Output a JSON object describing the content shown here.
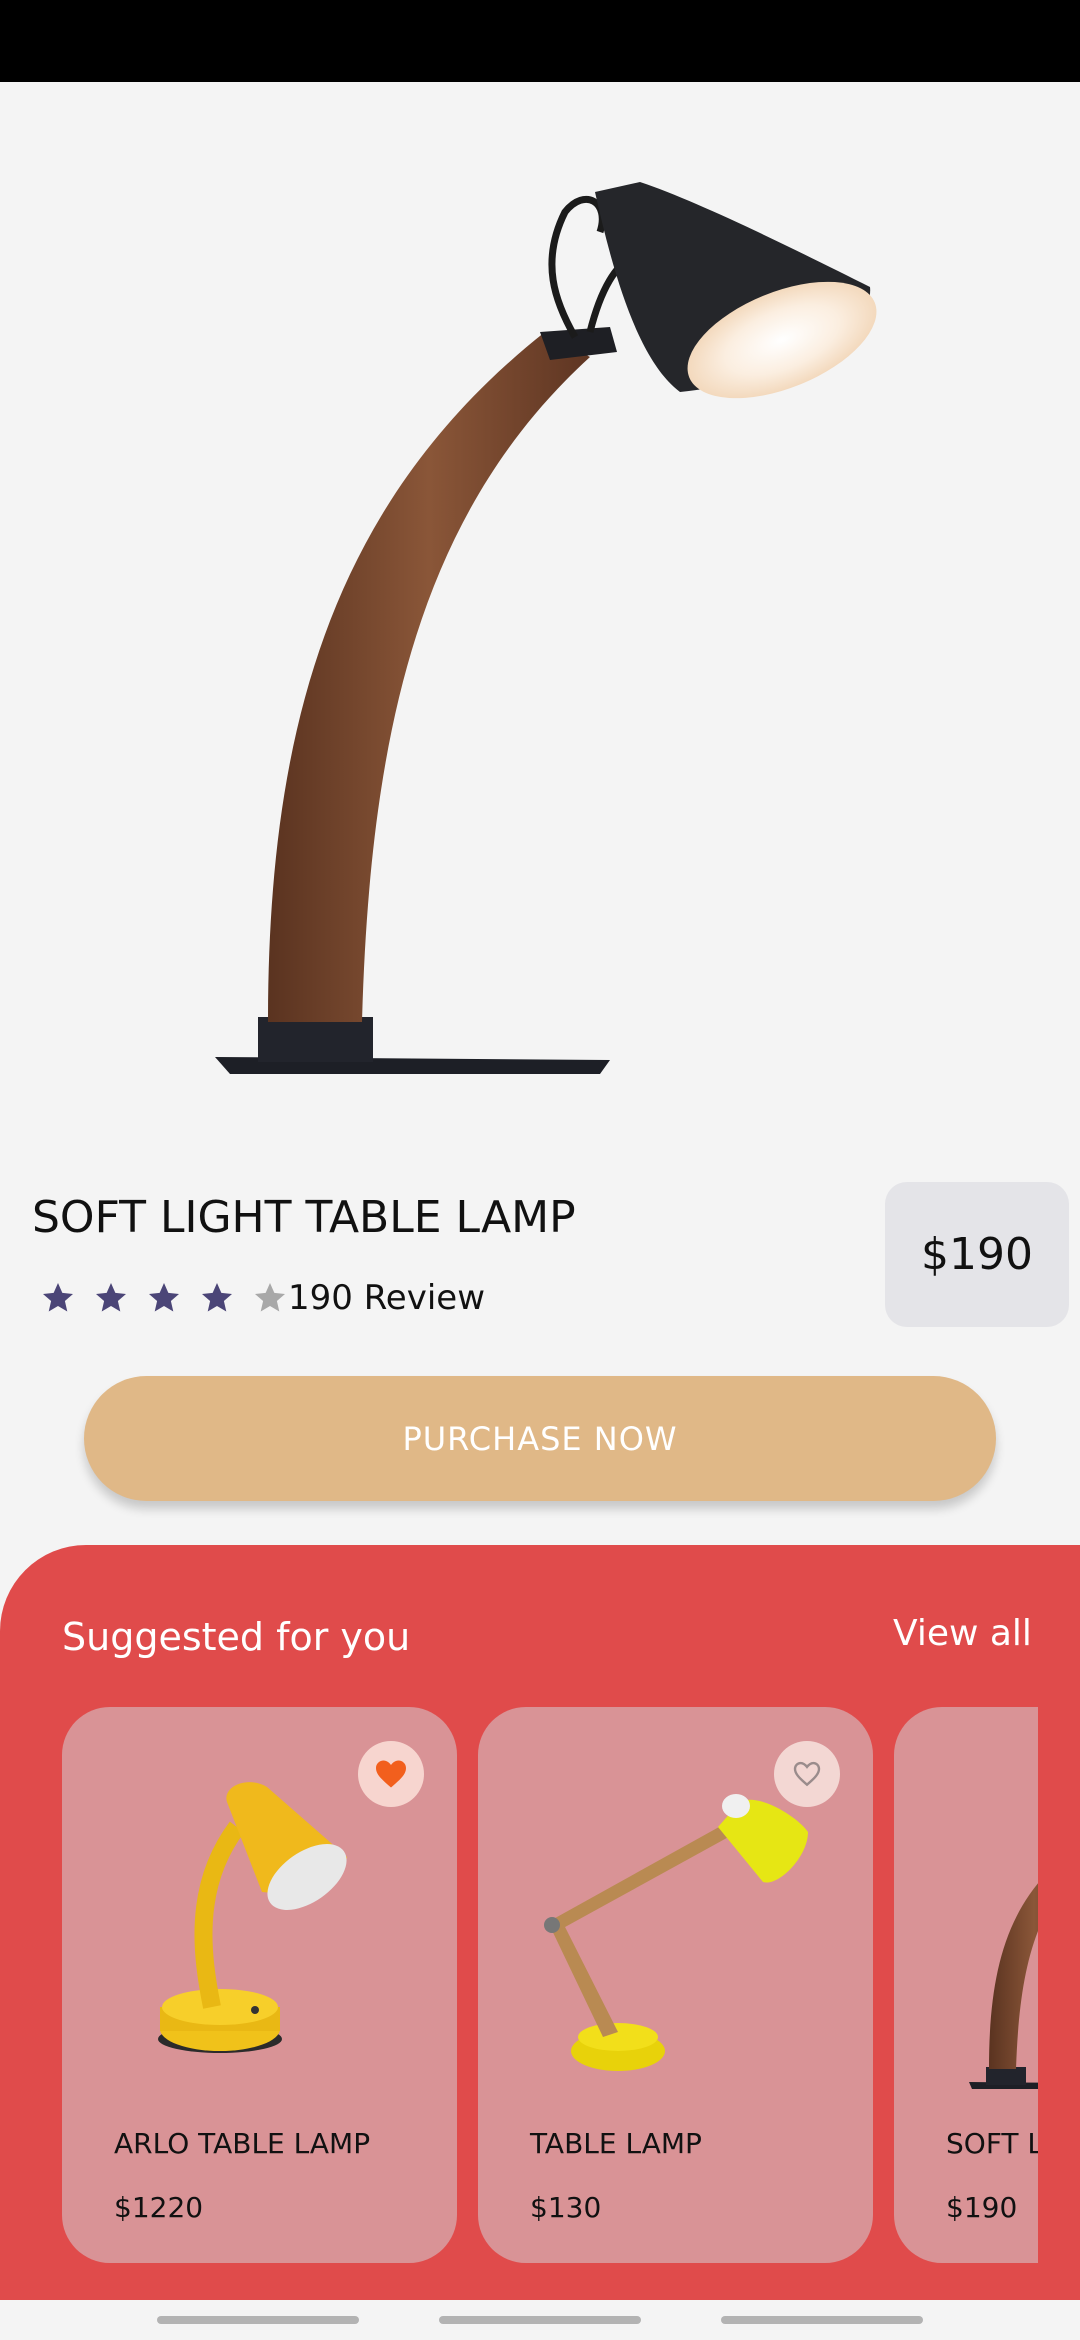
{
  "product": {
    "title": "SOFT LIGHT TABLE LAMP",
    "rating": 4,
    "rating_max": 5,
    "review_text": "190 Review",
    "price": "$190",
    "image_icon": "desk-lamp-image"
  },
  "actions": {
    "purchase_label": "PURCHASE NOW"
  },
  "suggested": {
    "title": "Suggested for you",
    "view_all": "View all",
    "items": [
      {
        "name": "ARLO TABLE LAMP",
        "price": "$1220",
        "favorite": true
      },
      {
        "name": "TABLE LAMP",
        "price": "$130",
        "favorite": false
      },
      {
        "name": "SOFT LIGHT TABLE LAMP",
        "price": "$190",
        "favorite": false
      }
    ]
  },
  "colors": {
    "accent_red": "#e04b4b",
    "button_tan": "#e0b887",
    "star_filled": "#4b4577",
    "star_empty": "#a8a8a8",
    "favorite_active": "#f25f1d",
    "card_bg": "#d99396"
  }
}
